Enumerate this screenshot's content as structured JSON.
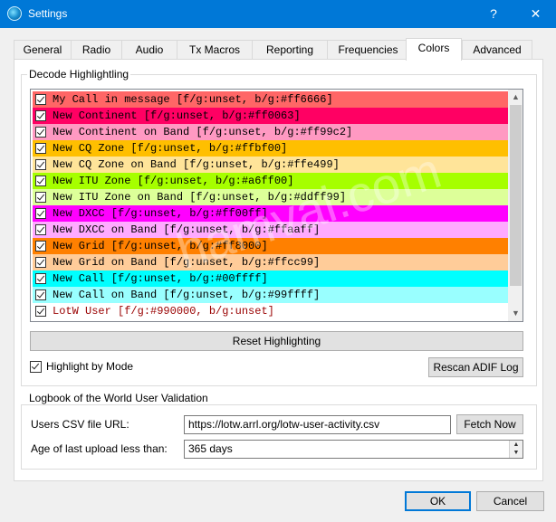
{
  "window": {
    "title": "Settings",
    "help_glyph": "?",
    "close_glyph": "✕"
  },
  "tabs": [
    "General",
    "Radio",
    "Audio",
    "Tx Macros",
    "Reporting",
    "Frequencies",
    "Colors",
    "Advanced"
  ],
  "active_tab": "Colors",
  "decode": {
    "group_title": "Decode Highlightling",
    "rows": [
      {
        "text": "My Call in message [f/g:unset, b/g:#ff6666]",
        "bg": "#ff6666",
        "fg": "#000000"
      },
      {
        "text": "New Continent [f/g:unset, b/g:#ff0063]",
        "bg": "#ff0063",
        "fg": "#000000"
      },
      {
        "text": "New Continent on Band [f/g:unset, b/g:#ff99c2]",
        "bg": "#ff99c2",
        "fg": "#000000"
      },
      {
        "text": "New CQ Zone [f/g:unset, b/g:#ffbf00]",
        "bg": "#ffbf00",
        "fg": "#000000"
      },
      {
        "text": "New CQ Zone on Band [f/g:unset, b/g:#ffe499]",
        "bg": "#ffe499",
        "fg": "#000000"
      },
      {
        "text": "New ITU Zone [f/g:unset, b/g:#a6ff00]",
        "bg": "#a6ff00",
        "fg": "#000000"
      },
      {
        "text": "New ITU Zone on Band [f/g:unset, b/g:#ddff99]",
        "bg": "#ddff99",
        "fg": "#000000"
      },
      {
        "text": "New DXCC [f/g:unset, b/g:#ff00ff]",
        "bg": "#ff00ff",
        "fg": "#000000"
      },
      {
        "text": "New DXCC on Band [f/g:unset, b/g:#ffaaff]",
        "bg": "#ffaaff",
        "fg": "#000000"
      },
      {
        "text": "New Grid [f/g:unset, b/g:#ff8000]",
        "bg": "#ff8000",
        "fg": "#000000"
      },
      {
        "text": "New Grid on Band [f/g:unset, b/g:#ffcc99]",
        "bg": "#ffcc99",
        "fg": "#000000"
      },
      {
        "text": "New Call [f/g:unset, b/g:#00ffff]",
        "bg": "#00ffff",
        "fg": "#000000"
      },
      {
        "text": "New Call on Band [f/g:unset, b/g:#99ffff]",
        "bg": "#99ffff",
        "fg": "#000000"
      },
      {
        "text": "LotW User [f/g:#990000, b/g:unset]",
        "bg": "#ffffff",
        "fg": "#990000"
      }
    ],
    "reset_label": "Reset Highlighting",
    "highlight_by_mode_label": "Highlight by Mode",
    "rescan_label": "Rescan ADIF Log"
  },
  "lotw": {
    "group_title": "Logbook of the World User Validation",
    "csv_label": "Users CSV file URL:",
    "csv_value": "https://lotw.arrl.org/lotw-user-activity.csv",
    "fetch_label": "Fetch Now",
    "age_label": "Age of last upload less than:",
    "age_value": "365 days"
  },
  "footer": {
    "ok_label": "OK",
    "cancel_label": "Cancel"
  },
  "watermark": "hamvai.com"
}
